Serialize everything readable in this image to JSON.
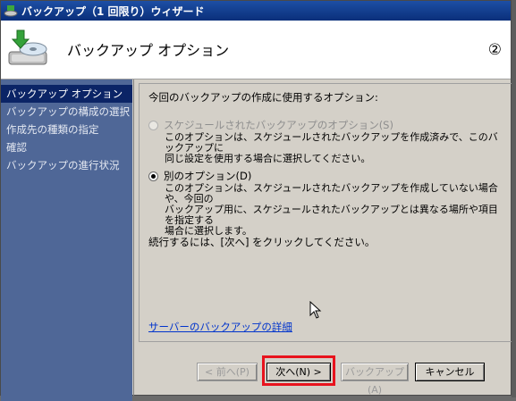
{
  "window": {
    "title": "バックアップ（1 回限り）ウィザード"
  },
  "header": {
    "title": "バックアップ オプション",
    "step_marker": "②"
  },
  "sidebar": {
    "items": [
      {
        "label": "バックアップ オプション"
      },
      {
        "label": "バックアップの構成の選択"
      },
      {
        "label": "作成先の種類の指定"
      },
      {
        "label": "確認"
      },
      {
        "label": "バックアップの進行状況"
      }
    ]
  },
  "main": {
    "prompt": "今回のバックアップの作成に使用するオプション:",
    "option_scheduled": {
      "label": "スケジュールされたバックアップのオプション(S)",
      "description_line1": "このオプションは、スケジュールされたバックアップを作成済みで、このバックアップに",
      "description_line2": "同じ設定を使用する場合に選択してください。"
    },
    "option_other": {
      "label": "別のオプション(D)",
      "description_line1": "このオプションは、スケジュールされたバックアップを作成していない場合や、今回の",
      "description_line2": "バックアップ用に、スケジュールされたバックアップとは異なる場所や項目を指定する",
      "description_line3": "場合に選択します。"
    },
    "continue_text": "続行するには、[次へ] をクリックしてください。",
    "details_link": "サーバーのバックアップの詳細"
  },
  "footer": {
    "back_label": "< 前へ(P)",
    "next_label": "次へ(N) >",
    "backup_label": "バックアップ(A)",
    "cancel_label": "キャンセル"
  },
  "colors": {
    "sidebar_bg": "#4f6797",
    "sidebar_active": "#0b2466",
    "title_bar": "#0a2f7a",
    "highlight": "#e8131d",
    "link": "#0033cc"
  }
}
